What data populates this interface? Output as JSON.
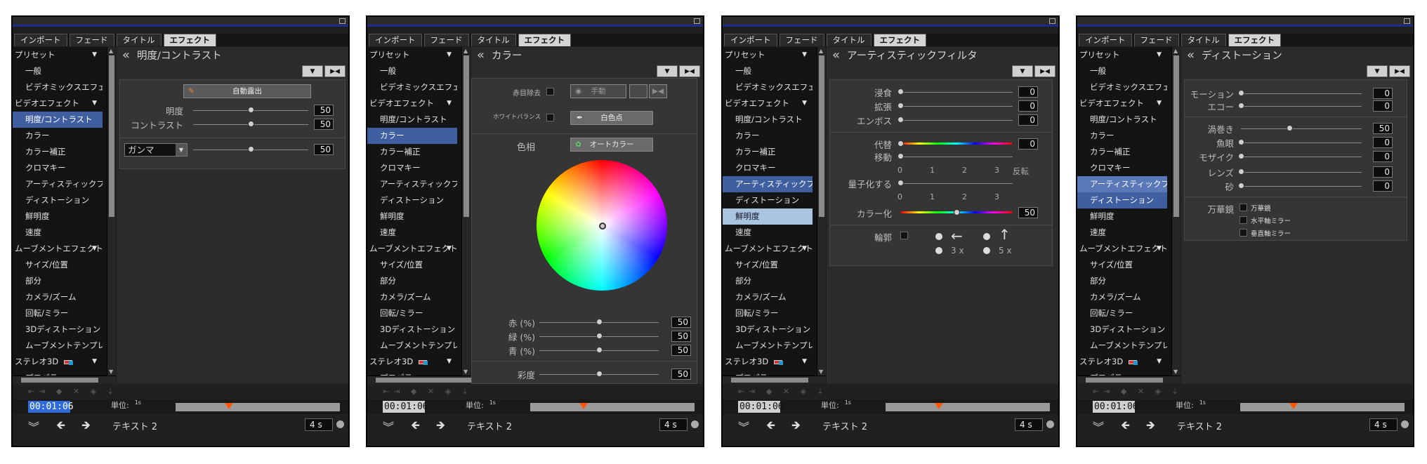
{
  "tabs": [
    "インポート",
    "フェード",
    "タイトル",
    "エフェクト"
  ],
  "list_items": [
    {
      "label": "プリセット",
      "cat": true
    },
    {
      "label": "一般"
    },
    {
      "label": "ビデオミックスエフェクト"
    },
    {
      "label": "ビデオエフェクト",
      "cat": true
    },
    {
      "label": "明度/コントラスト"
    },
    {
      "label": "カラー"
    },
    {
      "label": "カラー補正"
    },
    {
      "label": "クロマキー"
    },
    {
      "label": "アーティスティックフィルタ"
    },
    {
      "label": "ディストーション"
    },
    {
      "label": "鮮明度"
    },
    {
      "label": "速度"
    },
    {
      "label": "ムーブメントエフェクト",
      "cat": true
    },
    {
      "label": "サイズ/位置"
    },
    {
      "label": "部分"
    },
    {
      "label": "カメラ/ズーム"
    },
    {
      "label": "回転/ミラー"
    },
    {
      "label": "3Dディストーション"
    },
    {
      "label": "ムーブメントテンプレート"
    },
    {
      "label": "ステレオ3D",
      "cat": true,
      "glass": true
    },
    {
      "label": "プロパティ"
    }
  ],
  "bottom": {
    "time": "00:01:06",
    "unit_label": "単位:",
    "unit_value": "1s",
    "clip_text": "テキスト 2",
    "duration": "4 s"
  },
  "panels": [
    {
      "title": "明度/コントラスト",
      "selected": [
        4
      ],
      "auto_exposure": "自動露出",
      "brightness_label": "明度",
      "brightness": "50",
      "contrast_label": "コントラスト",
      "contrast": "50",
      "gamma_select": "ガンマ",
      "gamma": "50"
    },
    {
      "title": "カラー",
      "selected": [
        5
      ],
      "redeye_label": "赤目除去",
      "manual_button": "手動",
      "wb_label": "ホワイトバランス",
      "white_point_button": "白色点",
      "hue_label": "色相",
      "auto_color_button": "オートカラー",
      "red_label": "赤 (%)",
      "red": "50",
      "green_label": "緑 (%)",
      "green": "50",
      "blue_label": "青 (%)",
      "blue": "50",
      "saturation_label": "彩度",
      "saturation": "50"
    },
    {
      "title": "アーティスティックフィルタ",
      "selected": [
        8,
        10
      ],
      "erosion_label": "浸食",
      "erosion": "0",
      "dilation_label": "拡張",
      "dilation": "0",
      "emboss_label": "エンボス",
      "emboss": "0",
      "substitute_label": "代替",
      "substitute": "0",
      "shift_label": "移動",
      "ticks": [
        "0",
        "1",
        "2",
        "3"
      ],
      "invert_label": "反転",
      "quantize_label": "量子化する",
      "colorize_label": "カラー化",
      "colorize": "50",
      "contour_label": "輪郭",
      "x3_label": "3 x",
      "x5_label": "5 x"
    },
    {
      "title": "ディストーション",
      "selected": [
        8,
        9
      ],
      "motion_label": "モーション",
      "motion": "0",
      "echo_label": "エコー",
      "echo": "0",
      "vortex_label": "渦巻き",
      "vortex": "50",
      "fisheye_label": "魚眼",
      "fisheye": "0",
      "mosaic_label": "モザイク",
      "mosaic": "0",
      "lens_label": "レンズ",
      "lens": "0",
      "sand_label": "砂",
      "sand": "0",
      "kaleido_label": "万華鏡",
      "kaleido_opt1": "万華鏡",
      "kaleido_opt2": "水平軸ミラー",
      "kaleido_opt3": "垂直軸ミラー"
    }
  ]
}
